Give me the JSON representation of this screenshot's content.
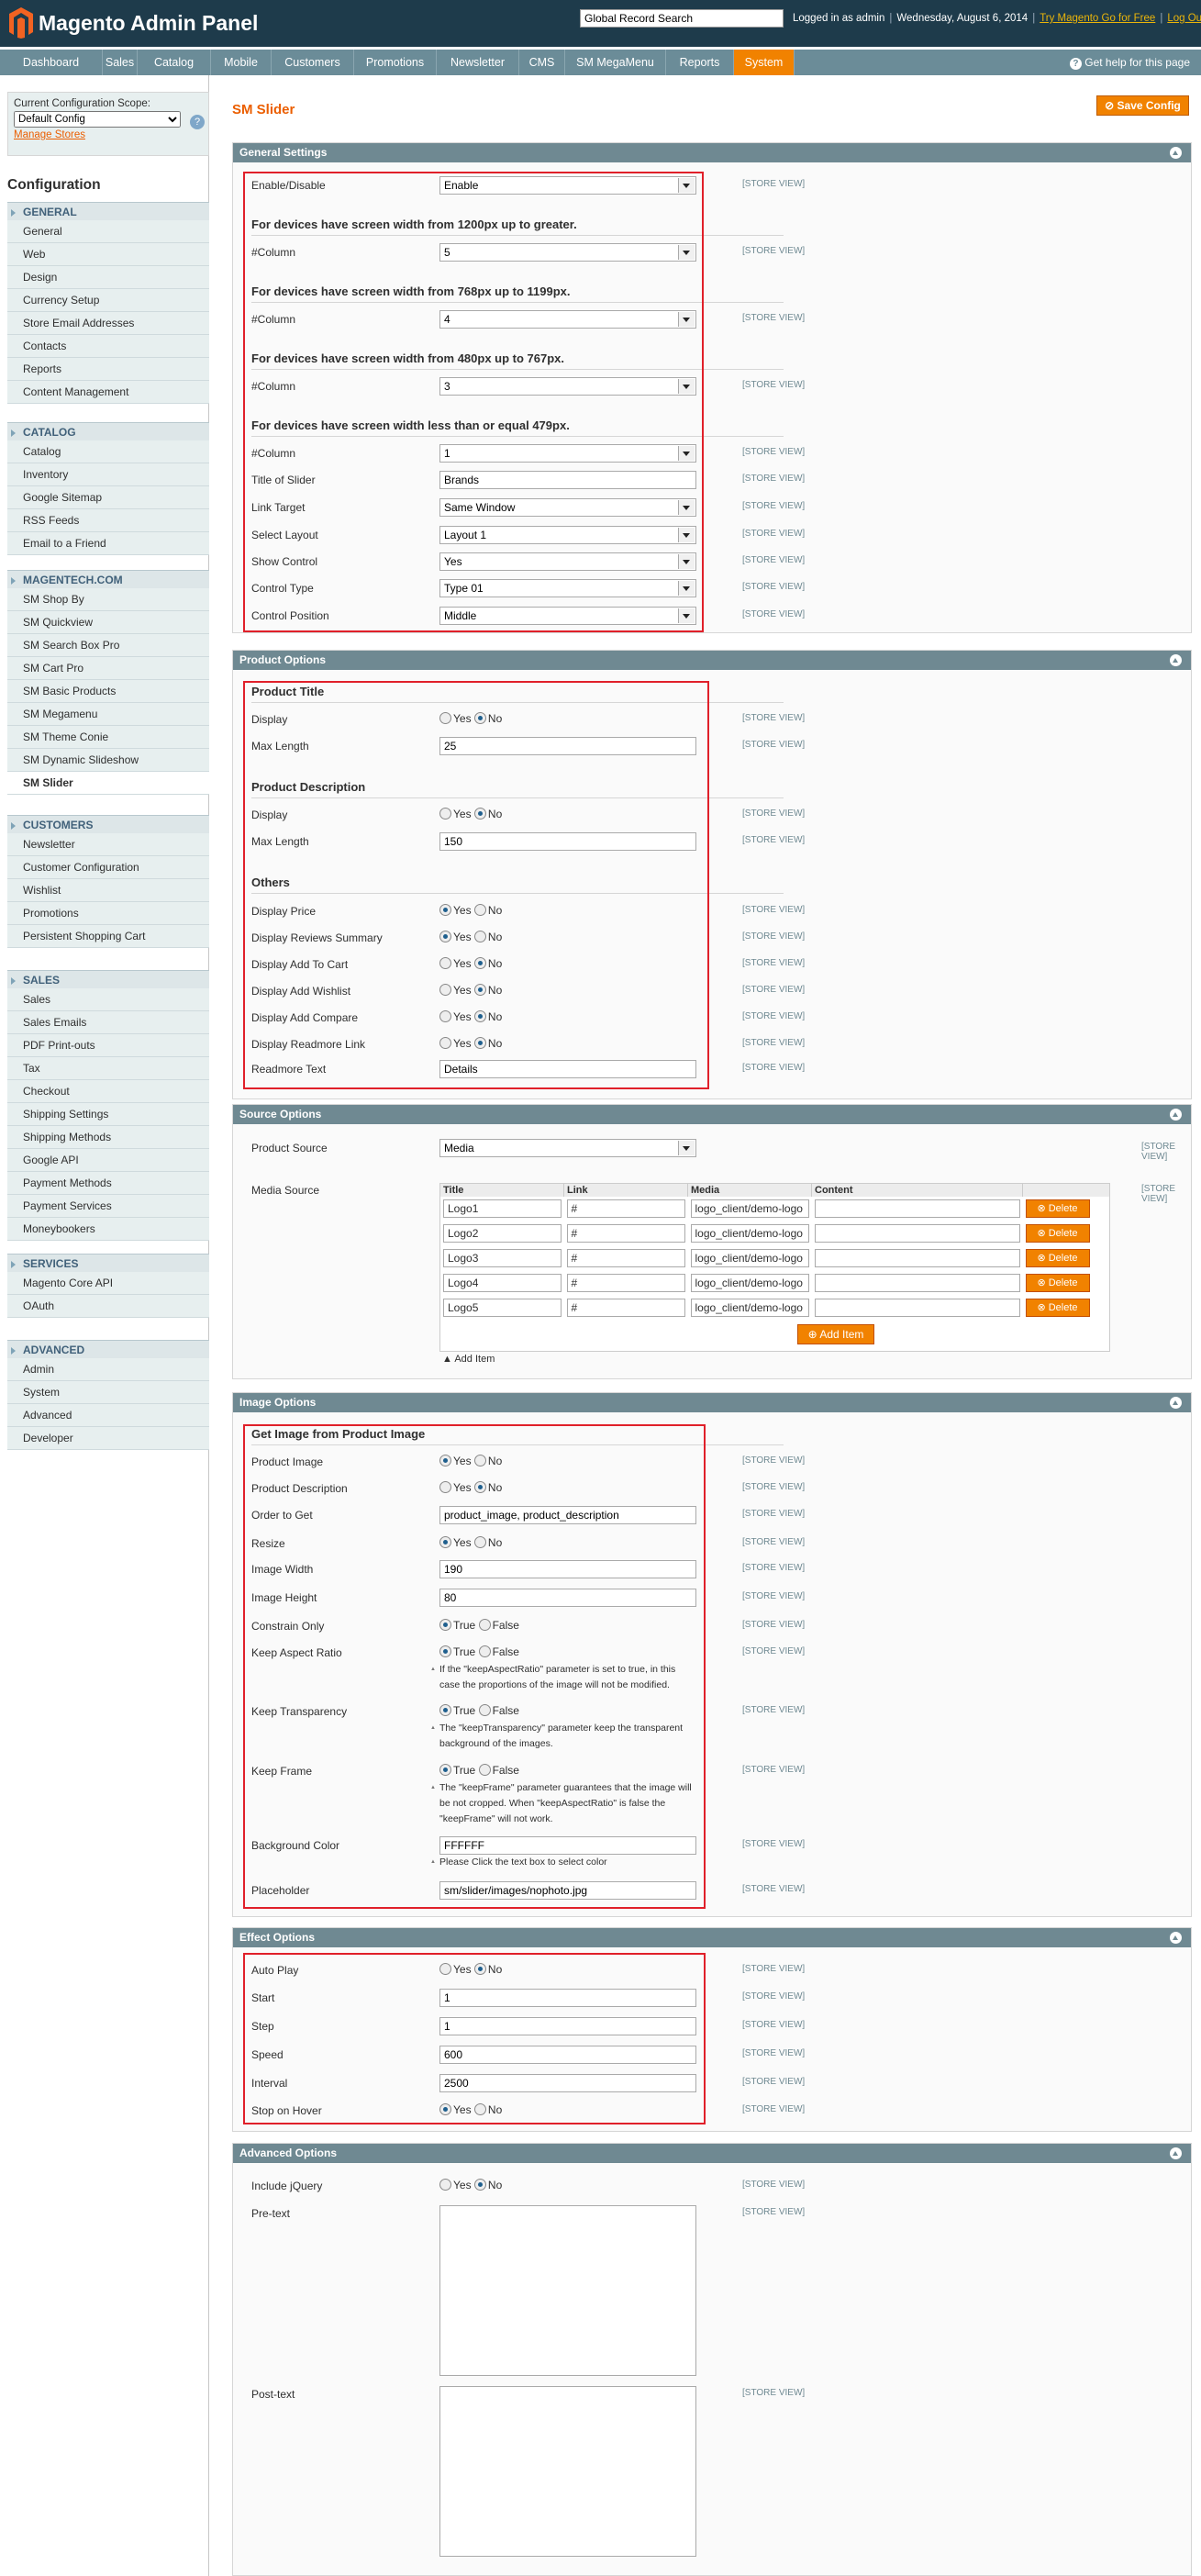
{
  "header": {
    "logo": "Magento Admin Panel",
    "search_value": "Global Record Search",
    "logged_in": "Logged in as admin",
    "date": "Wednesday, August 6, 2014",
    "try_link": "Try Magento Go for Free",
    "logout": "Log Out"
  },
  "nav": {
    "items": [
      "Dashboard",
      "Sales",
      "Catalog",
      "Mobile",
      "Customers",
      "Promotions",
      "Newsletter",
      "CMS",
      "SM MegaMenu",
      "Reports",
      "System"
    ],
    "active": "System",
    "help": "Get help for this page"
  },
  "sidebar": {
    "scope_label": "Current Configuration Scope:",
    "scope_value": "Default Config",
    "manage_stores": "Manage Stores",
    "title": "Configuration",
    "groups": [
      {
        "name": "GENERAL",
        "items": [
          "General",
          "Web",
          "Design",
          "Currency Setup",
          "Store Email Addresses",
          "Contacts",
          "Reports",
          "Content Management"
        ]
      },
      {
        "name": "CATALOG",
        "items": [
          "Catalog",
          "Inventory",
          "Google Sitemap",
          "RSS Feeds",
          "Email to a Friend"
        ]
      },
      {
        "name": "MAGENTECH.COM",
        "items": [
          "SM Shop By",
          "SM Quickview",
          "SM Search Box Pro",
          "SM Cart Pro",
          "SM Basic Products",
          "SM Megamenu",
          "SM Theme Conie",
          "SM Dynamic Slideshow",
          "SM Slider"
        ]
      },
      {
        "name": "CUSTOMERS",
        "items": [
          "Newsletter",
          "Customer Configuration",
          "Wishlist",
          "Promotions",
          "Persistent Shopping Cart"
        ]
      },
      {
        "name": "SALES",
        "items": [
          "Sales",
          "Sales Emails",
          "PDF Print-outs",
          "Tax",
          "Checkout",
          "Shipping Settings",
          "Shipping Methods",
          "Google API",
          "Payment Methods",
          "Payment Services",
          "Moneybookers"
        ]
      },
      {
        "name": "SERVICES",
        "items": [
          "Magento Core API",
          "OAuth"
        ]
      },
      {
        "name": "ADVANCED",
        "items": [
          "Admin",
          "System",
          "Advanced",
          "Developer"
        ]
      }
    ],
    "selected": "SM Slider"
  },
  "page_title": "SM Slider",
  "save_button": "Save Config",
  "store_view": "[STORE VIEW]",
  "store_view_a": "[STORE",
  "store_view_b": "VIEW]",
  "yes": "Yes",
  "no": "No",
  "true_lbl": "True",
  "false_lbl": "False",
  "general": {
    "title": "General Settings",
    "enable_label": "Enable/Disable",
    "enable_value": "Enable",
    "h1": "For devices have screen width from 1200px up to greater.",
    "col1": "5",
    "h2": "For devices have screen width from 768px up to 1199px.",
    "col2": "4",
    "h3": "For devices have screen width from 480px up to 767px.",
    "col3": "3",
    "h4": "For devices have screen width less than or equal 479px.",
    "col4": "1",
    "column_label": "#Column",
    "slider_title_label": "Title of Slider",
    "slider_title": "Brands",
    "link_target_label": "Link Target",
    "link_target": "Same Window",
    "layout_label": "Select Layout",
    "layout": "Layout 1",
    "show_control_label": "Show Control",
    "show_control": "Yes",
    "control_type_label": "Control Type",
    "control_type": "Type 01",
    "control_pos_label": "Control Position",
    "control_pos": "Middle"
  },
  "product": {
    "title": "Product Options",
    "h_title": "Product Title",
    "display_label": "Display",
    "max_label": "Max Length",
    "title_max": "25",
    "h_desc": "Product Description",
    "desc_max": "150",
    "h_others": "Others",
    "price": "Display Price",
    "reviews": "Display Reviews Summary",
    "cart": "Display Add To Cart",
    "wishlist": "Display Add Wishlist",
    "compare": "Display Add Compare",
    "readmore": "Display Readmore Link",
    "readmore_text_label": "Readmore Text",
    "readmore_text": "Details"
  },
  "source": {
    "title": "Source Options",
    "product_source_label": "Product Source",
    "product_source": "Media",
    "media_label": "Media Source",
    "columns": [
      "Title",
      "Link",
      "Media",
      "Content"
    ],
    "rows": [
      {
        "title": "Logo1",
        "link": "#",
        "media": "logo_client/demo-logo"
      },
      {
        "title": "Logo2",
        "link": "#",
        "media": "logo_client/demo-logo"
      },
      {
        "title": "Logo3",
        "link": "#",
        "media": "logo_client/demo-logo"
      },
      {
        "title": "Logo4",
        "link": "#",
        "media": "logo_client/demo-logo"
      },
      {
        "title": "Logo5",
        "link": "#",
        "media": "logo_client/demo-logo"
      }
    ],
    "delete": "Delete",
    "add_item": "Add Item",
    "add_item_link": "Add Item"
  },
  "image": {
    "title": "Image Options",
    "h": "Get Image from Product Image",
    "product_image": "Product Image",
    "product_desc": "Product Description",
    "order_label": "Order to Get",
    "order": "product_image, product_description",
    "resize": "Resize",
    "width_label": "Image Width",
    "width": "190",
    "height_label": "Image Height",
    "height": "80",
    "constrain": "Constrain Only",
    "aspect": "Keep Aspect Ratio",
    "aspect_note": "If the \"keepAspectRatio\" parameter is set to true, in this case the proportions of the image will not be modified.",
    "transparency": "Keep Transparency",
    "transparency_note": "The \"keepTransparency\" parameter keep the transparent background of the images.",
    "frame": "Keep Frame",
    "frame_note": "The \"keepFrame\" parameter guarantees that the image will be not cropped. When \"keepAspectRatio\" is false the \"keepFrame\" will not work.",
    "bg_label": "Background Color",
    "bg": "FFFFFF",
    "bg_note": "Please Click the text box to select color",
    "placeholder_label": "Placeholder",
    "placeholder": "sm/slider/images/nophoto.jpg"
  },
  "effect": {
    "title": "Effect Options",
    "autoplay": "Auto Play",
    "start_label": "Start",
    "start": "1",
    "step_label": "Step",
    "step": "1",
    "speed_label": "Speed",
    "speed": "600",
    "interval_label": "Interval",
    "interval": "2500",
    "hover": "Stop on Hover"
  },
  "advanced": {
    "title": "Advanced Options",
    "jquery": "Include jQuery",
    "pretext": "Pre-text",
    "posttext": "Post-text"
  }
}
